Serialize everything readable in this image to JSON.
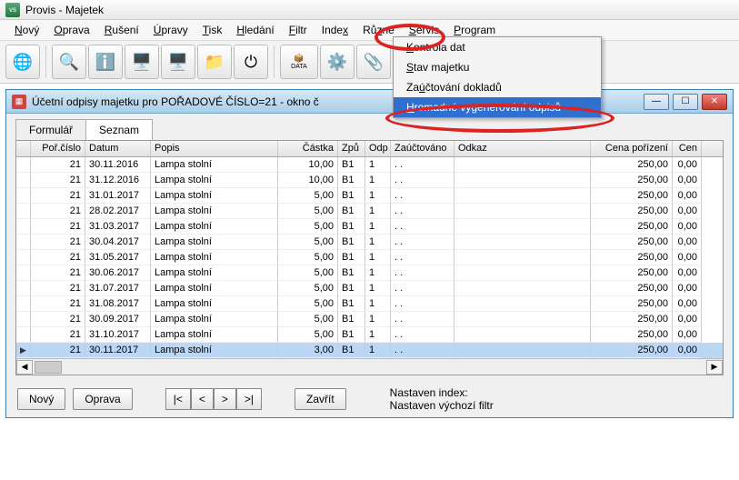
{
  "window": {
    "title": "Provis - Majetek"
  },
  "menubar": [
    "Nový",
    "Oprava",
    "Rušení",
    "Úpravy",
    "Tisk",
    "Hledání",
    "Filtr",
    "Index",
    "Různé",
    "Servis",
    "Program"
  ],
  "dropdown": {
    "items": [
      "Kontrola dat",
      "Stav majetku",
      "Zaúčtování dokladů",
      "Hromadné vygenerování odpisů"
    ],
    "highlight_index": 3
  },
  "subwindow": {
    "title": "Účetní odpisy majetku pro POŘADOVÉ ČÍSLO=21 - okno č"
  },
  "tabs": {
    "formular": "Formulář",
    "seznam": "Seznam",
    "active": 1
  },
  "grid": {
    "headers": [
      "",
      "Poř.číslo",
      "Datum",
      "Popis",
      "Částka",
      "Způ",
      "Odp",
      "Zaúčtováno",
      "Odkaz",
      "Cena pořízení",
      "Cen"
    ],
    "rows": [
      {
        "por": "21",
        "datum": "30.11.2016",
        "popis": "Lampa stolní",
        "castka": "10,00",
        "zpu": "B1",
        "odp": "1",
        "zauc": ". .",
        "odkaz": "",
        "cena": "250,00",
        "cen": "0,00"
      },
      {
        "por": "21",
        "datum": "31.12.2016",
        "popis": "Lampa stolní",
        "castka": "10,00",
        "zpu": "B1",
        "odp": "1",
        "zauc": ". .",
        "odkaz": "",
        "cena": "250,00",
        "cen": "0,00"
      },
      {
        "por": "21",
        "datum": "31.01.2017",
        "popis": "Lampa stolní",
        "castka": "5,00",
        "zpu": "B1",
        "odp": "1",
        "zauc": ". .",
        "odkaz": "",
        "cena": "250,00",
        "cen": "0,00"
      },
      {
        "por": "21",
        "datum": "28.02.2017",
        "popis": "Lampa stolní",
        "castka": "5,00",
        "zpu": "B1",
        "odp": "1",
        "zauc": ". .",
        "odkaz": "",
        "cena": "250,00",
        "cen": "0,00"
      },
      {
        "por": "21",
        "datum": "31.03.2017",
        "popis": "Lampa stolní",
        "castka": "5,00",
        "zpu": "B1",
        "odp": "1",
        "zauc": ". .",
        "odkaz": "",
        "cena": "250,00",
        "cen": "0,00"
      },
      {
        "por": "21",
        "datum": "30.04.2017",
        "popis": "Lampa stolní",
        "castka": "5,00",
        "zpu": "B1",
        "odp": "1",
        "zauc": ". .",
        "odkaz": "",
        "cena": "250,00",
        "cen": "0,00"
      },
      {
        "por": "21",
        "datum": "31.05.2017",
        "popis": "Lampa stolní",
        "castka": "5,00",
        "zpu": "B1",
        "odp": "1",
        "zauc": ". .",
        "odkaz": "",
        "cena": "250,00",
        "cen": "0,00"
      },
      {
        "por": "21",
        "datum": "30.06.2017",
        "popis": "Lampa stolní",
        "castka": "5,00",
        "zpu": "B1",
        "odp": "1",
        "zauc": ". .",
        "odkaz": "",
        "cena": "250,00",
        "cen": "0,00"
      },
      {
        "por": "21",
        "datum": "31.07.2017",
        "popis": "Lampa stolní",
        "castka": "5,00",
        "zpu": "B1",
        "odp": "1",
        "zauc": ". .",
        "odkaz": "",
        "cena": "250,00",
        "cen": "0,00"
      },
      {
        "por": "21",
        "datum": "31.08.2017",
        "popis": "Lampa stolní",
        "castka": "5,00",
        "zpu": "B1",
        "odp": "1",
        "zauc": ". .",
        "odkaz": "",
        "cena": "250,00",
        "cen": "0,00"
      },
      {
        "por": "21",
        "datum": "30.09.2017",
        "popis": "Lampa stolní",
        "castka": "5,00",
        "zpu": "B1",
        "odp": "1",
        "zauc": ". .",
        "odkaz": "",
        "cena": "250,00",
        "cen": "0,00"
      },
      {
        "por": "21",
        "datum": "31.10.2017",
        "popis": "Lampa stolní",
        "castka": "5,00",
        "zpu": "B1",
        "odp": "1",
        "zauc": ". .",
        "odkaz": "",
        "cena": "250,00",
        "cen": "0,00"
      },
      {
        "por": "21",
        "datum": "30.11.2017",
        "popis": "Lampa stolní",
        "castka": "3,00",
        "zpu": "B1",
        "odp": "1",
        "zauc": ". .",
        "odkaz": "",
        "cena": "250,00",
        "cen": "0,00",
        "selected": true,
        "marker": "▶"
      }
    ]
  },
  "buttons": {
    "novy": "Nový",
    "oprava": "Oprava",
    "first": "|<",
    "prev": "<",
    "next": ">",
    "last": ">|",
    "zavrit": "Zavřít"
  },
  "status": {
    "line1": "Nastaven index:",
    "line2": "Nastaven výchozí filtr"
  },
  "toolbar_icons": [
    "globe",
    "search",
    "info",
    "pc1",
    "pc2",
    "folder",
    "power",
    "sep",
    "data",
    "gear",
    "clip",
    "db1",
    "db2"
  ]
}
